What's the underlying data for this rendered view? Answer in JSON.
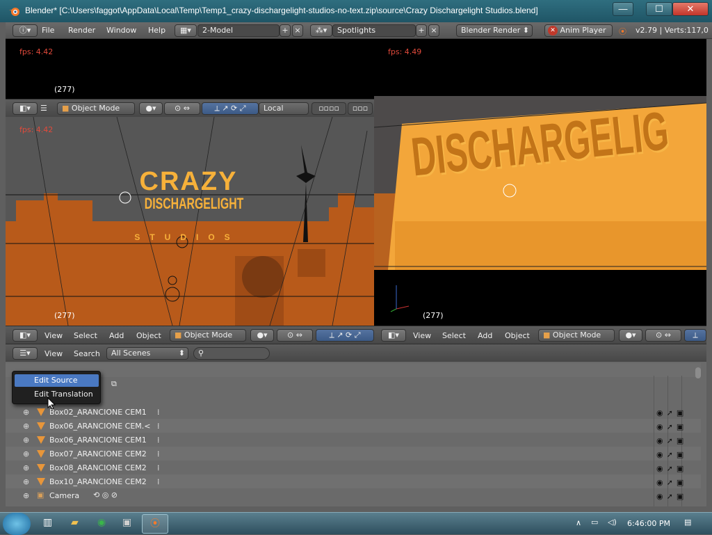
{
  "window": {
    "title": "Blender* [C:\\Users\\faggot\\AppData\\Local\\Temp\\Temp1_crazy-dischargelight-studios-no-text.zip\\source\\Crazy Dischargelight Studios.blend]",
    "min_glyph": "—",
    "max_glyph": "☐",
    "close_glyph": "✕"
  },
  "infobar": {
    "menus": [
      "File",
      "Render",
      "Window",
      "Help"
    ],
    "screen_layout": "2-Model",
    "scene": "Spotlights",
    "render_engine": "Blender Render",
    "anim_player": "Anim Player",
    "version_stats": "v2.79 | Verts:117,0"
  },
  "viewports": {
    "top_left": {
      "fps": "fps: 4.42",
      "frame": "(277)"
    },
    "main_left": {
      "fps": "fps: 4.42",
      "frame": "(277)",
      "logo_line1": "CRAZY",
      "logo_line2": "DISCHARGELIGHT",
      "logo_line3": "STUDIOS"
    },
    "right": {
      "fps": "fps: 4.49",
      "frame": "(277)",
      "render_text": "DISCHARGELIG"
    }
  },
  "mid_header": {
    "mode": "Object Mode",
    "orientation": "Local"
  },
  "bottom_header_left": {
    "menus": [
      "View",
      "Select",
      "Add",
      "Object"
    ],
    "mode": "Object Mode"
  },
  "bottom_header_right": {
    "menus": [
      "View",
      "Select",
      "Add",
      "Object"
    ],
    "mode": "Object Mode"
  },
  "outliner": {
    "menus": [
      "View",
      "Search"
    ],
    "display_mode": "All Scenes",
    "search_placeholder": "",
    "rows": [
      {
        "name": "Box02_ARANCIONE CEM1"
      },
      {
        "name": "Box06_ARANCIONE CEM.<"
      },
      {
        "name": "Box06_ARANCIONE CEM1"
      },
      {
        "name": "Box07_ARANCIONE CEM2"
      },
      {
        "name": "Box08_ARANCIONE CEM2"
      },
      {
        "name": "Box10_ARANCIONE CEM2"
      },
      {
        "name": "Camera"
      }
    ]
  },
  "context_menu": {
    "items": [
      "Edit Source",
      "Edit Translation"
    ],
    "selected_index": 0
  },
  "taskbar": {
    "clock": "6:46:00 PM"
  },
  "colors": {
    "viewport_orange": "#b85a1a",
    "logo_yellow": "#f7b13a",
    "highlight_blue": "#4a79c2"
  }
}
